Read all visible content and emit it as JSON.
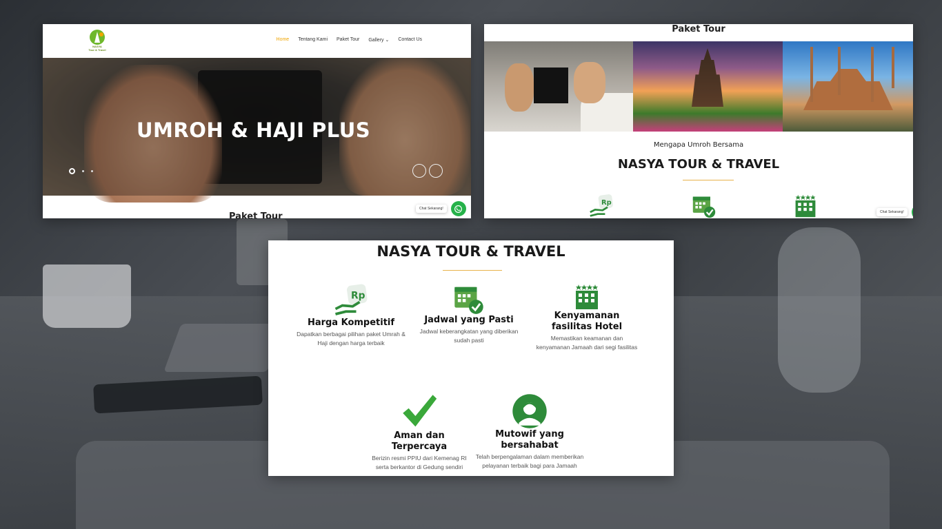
{
  "colors": {
    "brand_green": "#2e8b3a",
    "accent_orange": "#f0a500",
    "divider_gold": "#e8b24a",
    "whatsapp_green": "#26b24a"
  },
  "frame1": {
    "logo": {
      "name": "NASYA",
      "tagline": "Tour & Travel"
    },
    "nav": [
      "Home",
      "Tentang Kami",
      "Paket Tour",
      "Gallery",
      "Contact Us"
    ],
    "nav_active": "Home",
    "hero_title": "UMROH & HAJI PLUS",
    "section_title": "Paket Tour",
    "chat_label": "Chat Sekarang!"
  },
  "frame2": {
    "section_title": "Paket Tour",
    "subtitle": "Mengapa Umroh Bersama",
    "brand": "NASYA TOUR & TRAVEL",
    "chat_label": "Chat Sekarang!"
  },
  "frame3": {
    "brand": "NASYA TOUR & TRAVEL",
    "features": [
      {
        "icon": "rupiah-hand-icon",
        "title": "Harga Kompetitif",
        "desc": "Dapatkan berbagai pilihan paket Umrah & Haji dengan harga terbaik"
      },
      {
        "icon": "calendar-check-icon",
        "title": "Jadwal yang Pasti",
        "desc": "Jadwal keberangkatan yang diberikan sudah pasti"
      },
      {
        "icon": "hotel-icon",
        "title": "Kenyamanan fasilitas Hotel",
        "desc": "Memastikan keamanan dan kenyamanan Jamaah dari segi fasilitas"
      },
      {
        "icon": "checkmark-icon",
        "title": "Aman dan Terpercaya",
        "desc": "Berizin resmi PPIU dari Kemenag RI serta berkantor di Gedung sendiri"
      },
      {
        "icon": "guide-person-icon",
        "title": "Mutowif yang bersahabat",
        "desc": "Telah berpengalaman dalam memberikan pelayanan terbaik bagi para Jamaah"
      }
    ]
  }
}
